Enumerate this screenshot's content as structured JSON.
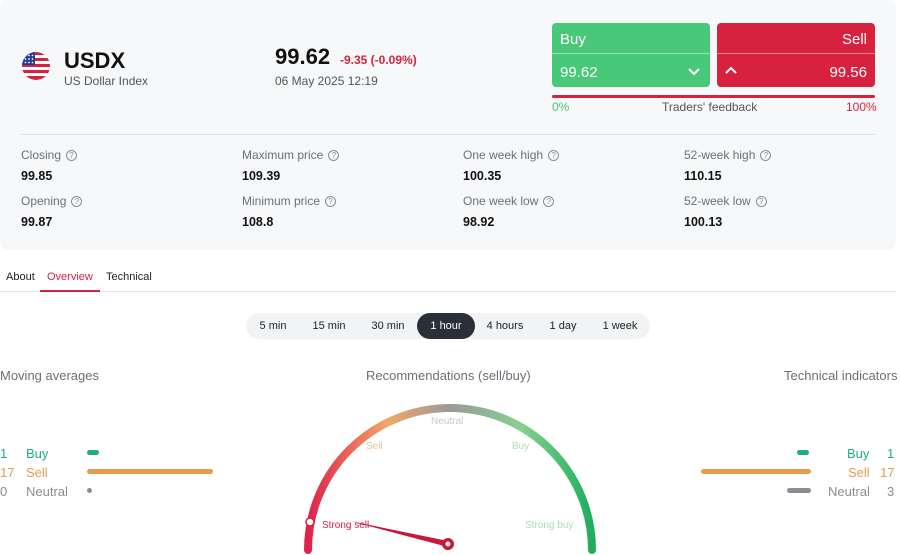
{
  "instrument": {
    "symbol": "USDX",
    "name": "US Dollar Index",
    "price": "99.62",
    "change": "-9.35 (-0.09%)",
    "datetime": "06 May 2025 12:19",
    "flag_icon": "us-flag-icon"
  },
  "trade": {
    "buy_label": "Buy",
    "buy_value": "99.62",
    "sell_label": "Sell",
    "sell_value": "99.56",
    "buy_color": "#4ac87a",
    "sell_color": "#d6223f",
    "feedback_left": "0%",
    "feedback_label": "Traders' feedback",
    "feedback_right": "100%",
    "feedback_buy_share": 0
  },
  "stats": [
    {
      "label": "Closing",
      "value": "99.85"
    },
    {
      "label": "Maximum price",
      "value": "109.39"
    },
    {
      "label": "One week high",
      "value": "100.35"
    },
    {
      "label": "52-week high",
      "value": "110.15"
    },
    {
      "label": "Opening",
      "value": "99.87"
    },
    {
      "label": "Minimum price",
      "value": "108.8"
    },
    {
      "label": "One week low",
      "value": "98.92"
    },
    {
      "label": "52-week low",
      "value": "100.13"
    }
  ],
  "tabs": [
    {
      "label": "About",
      "active": false
    },
    {
      "label": "Overview",
      "active": true
    },
    {
      "label": "Technical",
      "active": false
    }
  ],
  "periods": [
    {
      "label": "5 min",
      "active": false
    },
    {
      "label": "15 min",
      "active": false
    },
    {
      "label": "30 min",
      "active": false
    },
    {
      "label": "1 hour",
      "active": true
    },
    {
      "label": "4 hours",
      "active": false
    },
    {
      "label": "1 day",
      "active": false
    },
    {
      "label": "1 week",
      "active": false
    }
  ],
  "moving_averages": {
    "title": "Moving averages",
    "buy": {
      "count": "1",
      "label": "Buy"
    },
    "sell": {
      "count": "17",
      "label": "Sell"
    },
    "neutral": {
      "count": "0",
      "label": "Neutral"
    }
  },
  "recommendations": {
    "title": "Recommendations (sell/buy)",
    "labels": {
      "strong_sell": "Strong sell",
      "sell": "Sell",
      "neutral": "Neutral",
      "buy": "Buy",
      "strong_buy": "Strong buy"
    },
    "needle_position": "Strong sell"
  },
  "technical_indicators": {
    "title": "Technical indicators",
    "buy": {
      "count": "1",
      "label": "Buy"
    },
    "sell": {
      "count": "17",
      "label": "Sell"
    },
    "neutral": {
      "count": "3",
      "label": "Neutral"
    }
  },
  "colors": {
    "buy": "#1fae7e",
    "sell": "#e89b4c",
    "neutral": "#8a8d93",
    "accent": "#d6223f"
  }
}
